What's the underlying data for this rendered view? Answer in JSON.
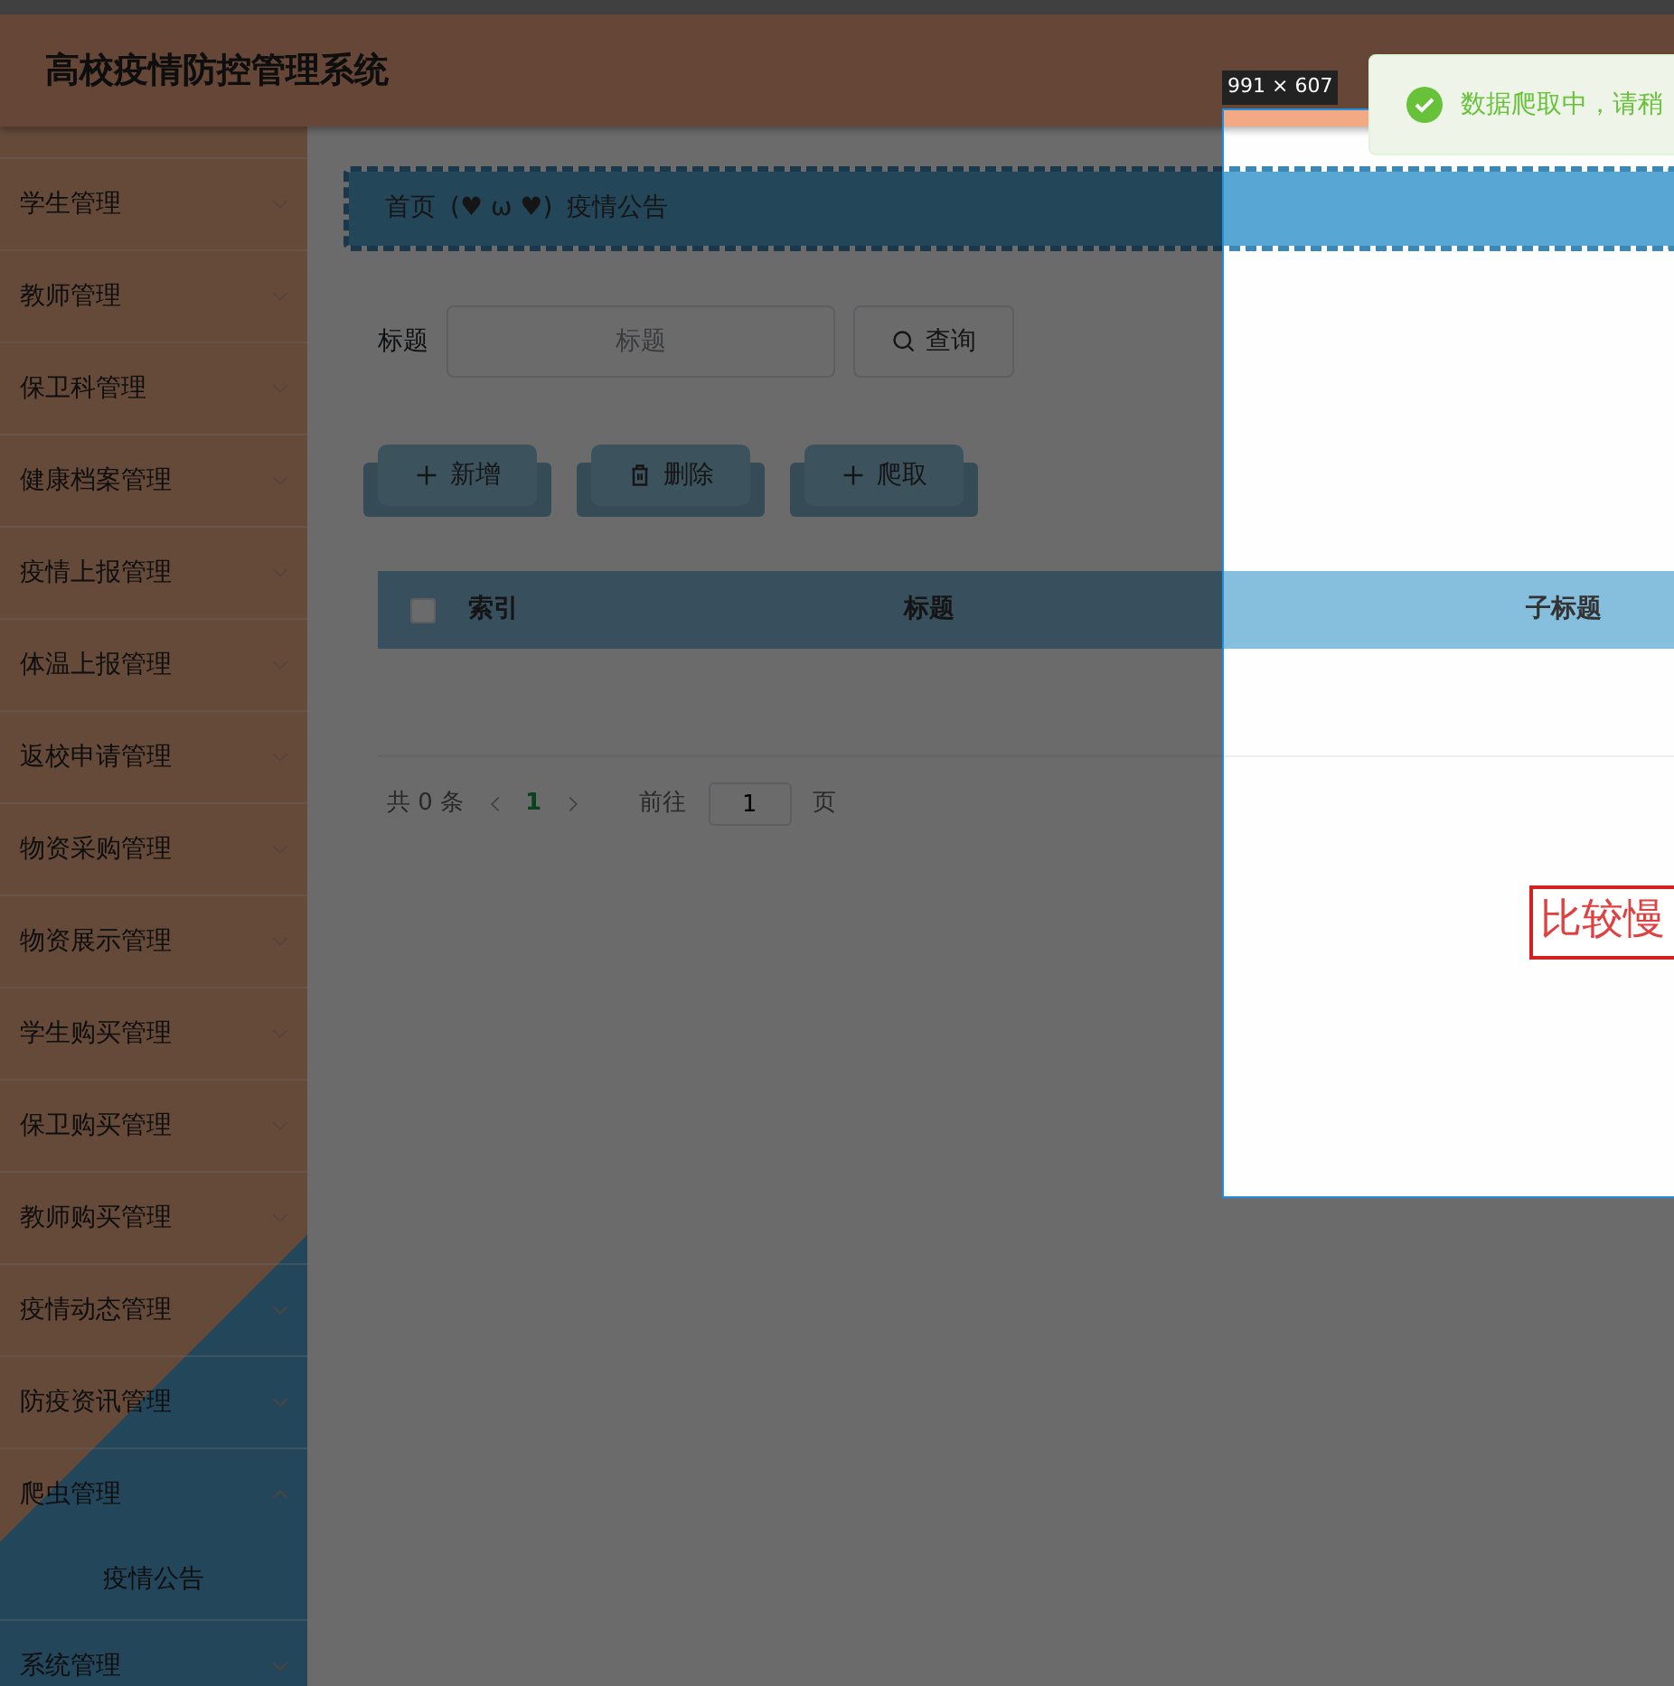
{
  "header": {
    "title": "高校疫情防控管理系统"
  },
  "sidebar": {
    "items": [
      {
        "label": "学生管理",
        "expanded": false
      },
      {
        "label": "教师管理",
        "expanded": false
      },
      {
        "label": "保卫科管理",
        "expanded": false
      },
      {
        "label": "健康档案管理",
        "expanded": false
      },
      {
        "label": "疫情上报管理",
        "expanded": false
      },
      {
        "label": "体温上报管理",
        "expanded": false
      },
      {
        "label": "返校申请管理",
        "expanded": false
      },
      {
        "label": "物资采购管理",
        "expanded": false
      },
      {
        "label": "物资展示管理",
        "expanded": false
      },
      {
        "label": "学生购买管理",
        "expanded": false
      },
      {
        "label": "保卫购买管理",
        "expanded": false
      },
      {
        "label": "教师购买管理",
        "expanded": false
      },
      {
        "label": "疫情动态管理",
        "expanded": false
      },
      {
        "label": "防疫资讯管理",
        "expanded": false
      },
      {
        "label": "爬虫管理",
        "expanded": true,
        "children": [
          {
            "label": "疫情公告"
          }
        ]
      },
      {
        "label": "系统管理",
        "expanded": false
      }
    ]
  },
  "breadcrumb": {
    "home": "首页",
    "separator": "(♥ ω ♥)",
    "current": "疫情公告"
  },
  "search": {
    "label": "标题",
    "placeholder": "标题",
    "button": "查询"
  },
  "actions": [
    {
      "label": "新增",
      "kind": "add"
    },
    {
      "label": "删除",
      "kind": "delete"
    },
    {
      "label": "爬取",
      "kind": "add"
    }
  ],
  "table": {
    "select_all_checked": false,
    "columns": [
      "索引",
      "标题",
      "子标题"
    ]
  },
  "pagination": {
    "total": "共 0 条",
    "pages": [
      {
        "label": "1",
        "selected": true
      }
    ],
    "goto_label": "前往",
    "goto_value": "1",
    "page_unit": "页"
  },
  "capture": {
    "size_label": "991 × 607"
  },
  "toast": {
    "message": "数据爬取中，请稍"
  },
  "annotation": {
    "text": "比较慢"
  }
}
